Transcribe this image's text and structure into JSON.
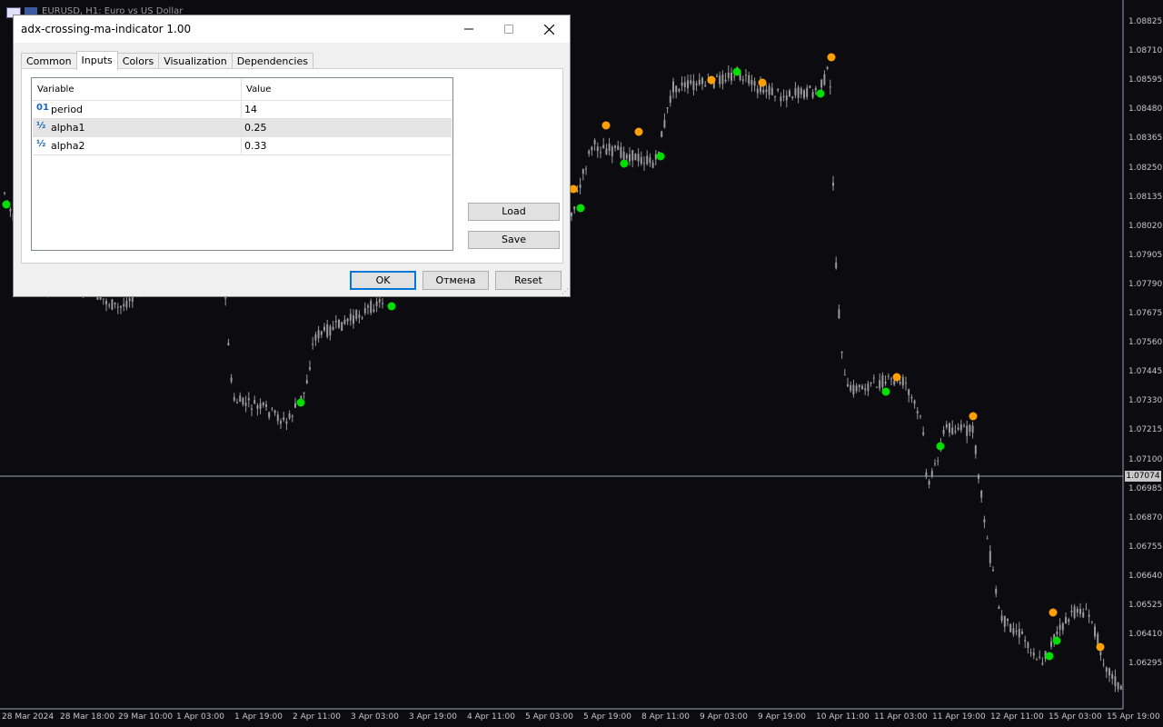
{
  "chart": {
    "title": "EURUSD, H1:  Euro vs US Dollar",
    "current_price": "1.07074",
    "price_labels": [
      "1.08825",
      "1.08710",
      "1.08595",
      "1.08480",
      "1.08365",
      "1.08250",
      "1.08135",
      "1.08020",
      "1.07905",
      "1.07790",
      "1.07675",
      "1.07560",
      "1.07445",
      "1.07330",
      "1.07215",
      "1.07100",
      "1.06985",
      "1.06870",
      "1.06755",
      "1.06640",
      "1.06525",
      "1.06410",
      "1.06295"
    ],
    "time_labels": [
      "28 Mar 2024",
      "28 Mar 18:00",
      "29 Mar 10:00",
      "1 Apr 03:00",
      "1 Apr 19:00",
      "2 Apr 11:00",
      "3 Apr 03:00",
      "3 Apr 19:00",
      "4 Apr 11:00",
      "5 Apr 03:00",
      "5 Apr 19:00",
      "8 Apr 11:00",
      "9 Apr 03:00",
      "9 Apr 19:00",
      "10 Apr 11:00",
      "11 Apr 03:00",
      "11 Apr 19:00",
      "12 Apr 11:00",
      "15 Apr 03:00",
      "15 Apr 19:00"
    ],
    "colors": {
      "background": "#0b0b10",
      "candle": "#9a9a9a",
      "signal_up": "#00e000",
      "signal_down": "#ffa000",
      "grid_text": "#c8c8c8",
      "price_line": "#9aa4b0"
    }
  },
  "dialog": {
    "title": "adx-crossing-ma-indicator 1.00",
    "window_buttons": {
      "minimize": "minimize-icon",
      "maximize": "maximize-icon",
      "close": "close-icon"
    },
    "tabs": [
      {
        "label": "Common"
      },
      {
        "label": "Inputs",
        "active": true
      },
      {
        "label": "Colors"
      },
      {
        "label": "Visualization"
      },
      {
        "label": "Dependencies"
      }
    ],
    "table": {
      "headers": {
        "variable": "Variable",
        "value": "Value"
      },
      "rows": [
        {
          "icon": "01",
          "name": "period",
          "value": "14"
        },
        {
          "icon": "½",
          "name": "alpha1",
          "value": "0.25",
          "selected": true
        },
        {
          "icon": "½",
          "name": "alpha2",
          "value": "0.33"
        }
      ]
    },
    "buttons": {
      "load": "Load",
      "save": "Save",
      "ok": "OK",
      "cancel": "Отмена",
      "reset": "Reset"
    }
  }
}
